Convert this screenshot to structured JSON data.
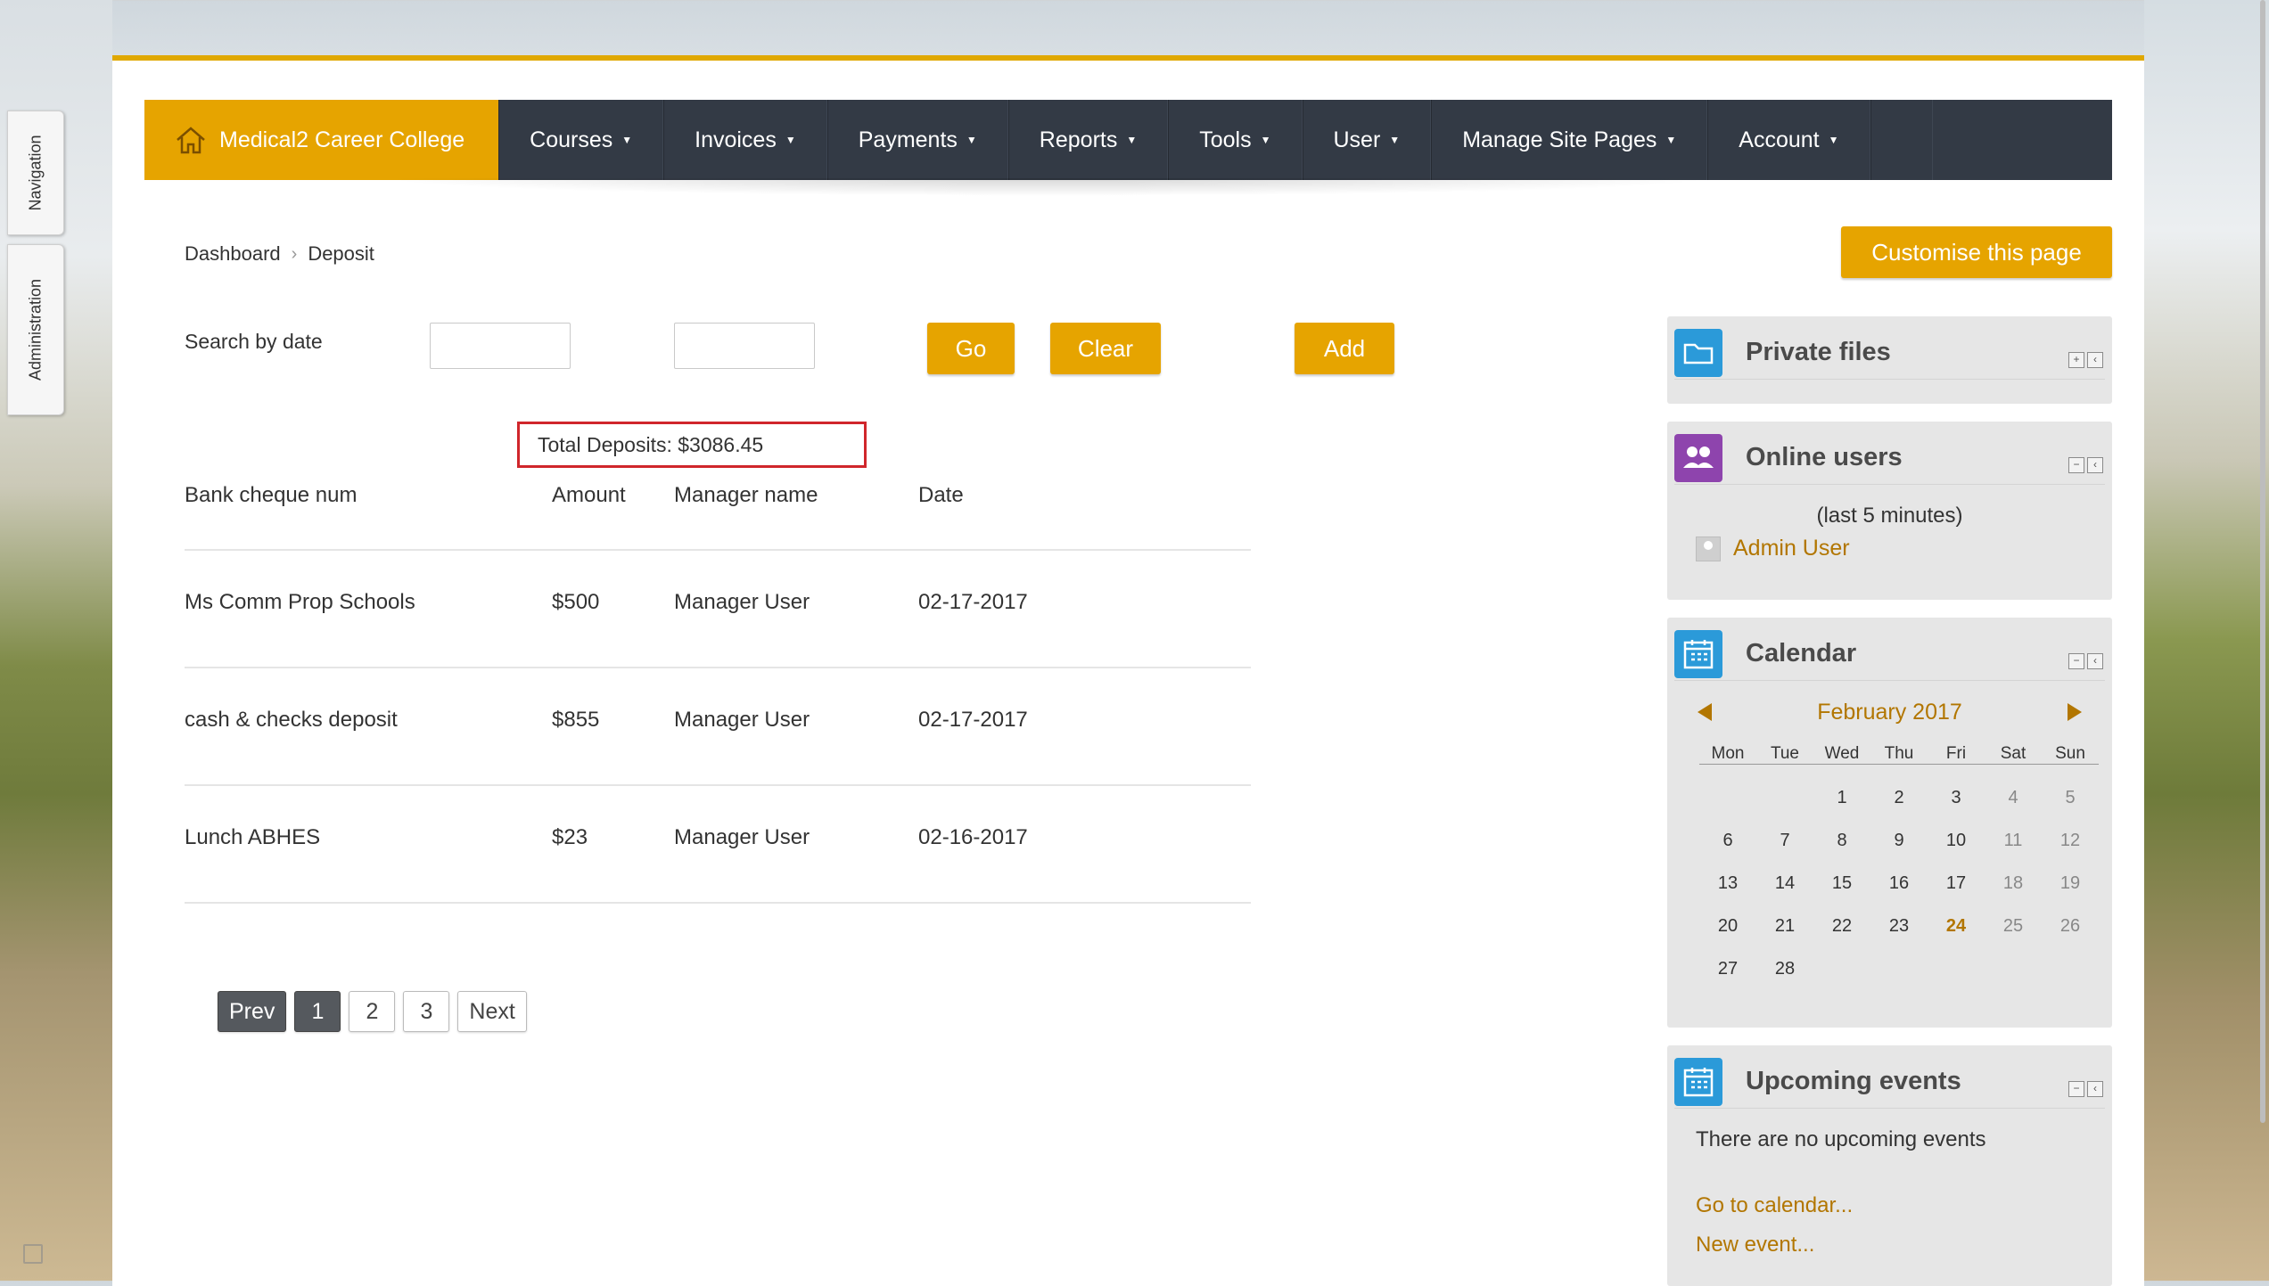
{
  "sidebar_tabs": {
    "navigation": "Navigation",
    "administration": "Administration"
  },
  "nav": {
    "brand": "Medical2 Career College",
    "items": [
      "Courses",
      "Invoices",
      "Payments",
      "Reports",
      "Tools",
      "User",
      "Manage Site Pages",
      "Account"
    ]
  },
  "breadcrumb": {
    "home": "Dashboard",
    "current": "Deposit"
  },
  "customise_button": "Customise this page",
  "search": {
    "label": "Search by date",
    "from_value": "",
    "to_value": "",
    "go": "Go",
    "clear": "Clear",
    "add": "Add"
  },
  "total_deposits": "Total Deposits: $3086.45",
  "table": {
    "headers": [
      "Bank cheque num",
      "Amount",
      "Manager name",
      "Date"
    ],
    "rows": [
      [
        "Ms Comm Prop Schools",
        "$500",
        "Manager User",
        "02-17-2017"
      ],
      [
        "cash & checks deposit",
        "$855",
        "Manager User",
        "02-17-2017"
      ],
      [
        "Lunch ABHES",
        "$23",
        "Manager User",
        "02-16-2017"
      ]
    ]
  },
  "pager": {
    "prev": "Prev",
    "pages": [
      "1",
      "2",
      "3"
    ],
    "next": "Next",
    "current": "1"
  },
  "blocks": {
    "private_files": {
      "title": "Private files"
    },
    "online_users": {
      "title": "Online users",
      "subtitle": "(last 5 minutes)",
      "user": "Admin User"
    },
    "calendar": {
      "title": "Calendar",
      "month": "February 2017",
      "weekdays": [
        "Mon",
        "Tue",
        "Wed",
        "Thu",
        "Fri",
        "Sat",
        "Sun"
      ],
      "weeks": [
        [
          "",
          "",
          "1",
          "2",
          "3",
          "4",
          "5"
        ],
        [
          "6",
          "7",
          "8",
          "9",
          "10",
          "11",
          "12"
        ],
        [
          "13",
          "14",
          "15",
          "16",
          "17",
          "18",
          "19"
        ],
        [
          "20",
          "21",
          "22",
          "23",
          "24",
          "25",
          "26"
        ],
        [
          "27",
          "28",
          "",
          "",
          "",
          "",
          ""
        ]
      ],
      "today": "24"
    },
    "upcoming_events": {
      "title": "Upcoming events",
      "empty_text": "There are no upcoming events",
      "go_link": "Go to calendar...",
      "new_link": "New event..."
    }
  },
  "colors": {
    "accent": "#e6a400",
    "nav_bg": "#333a45",
    "link": "#b27600",
    "highlight_border": "#d0262b"
  }
}
